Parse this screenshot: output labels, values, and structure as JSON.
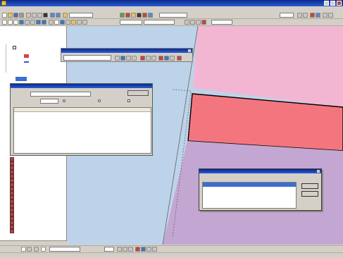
{
  "app": {
    "title": ""
  },
  "menubar": {
    "items": [
      "",
      "",
      "",
      "",
      "",
      "",
      "",
      "",
      "",
      "",
      ""
    ]
  },
  "toolbar": {
    "scale_value": "",
    "layer_combo_value": "",
    "target_combo_value": "",
    "editor_label": "",
    "small_combo_value": "",
    "small_combo2_value": ""
  },
  "toc": {
    "layers_label": "",
    "items": [
      "",
      "",
      "",
      "",
      ""
    ]
  },
  "georef_toolbar": {
    "title": "",
    "combo_value": ""
  },
  "find_dialog": {
    "title": "",
    "input_label": "",
    "input_value": "",
    "in_label": "",
    "option_labels": [
      "",
      "",
      ""
    ],
    "columns": [
      "",
      "",
      "",
      ""
    ],
    "rows": [
      [
        "",
        "",
        "",
        ""
      ]
    ]
  },
  "toolbox": {
    "items": [
      "",
      "",
      "",
      "",
      "",
      "",
      "",
      "",
      "",
      "",
      "",
      "",
      "",
      "",
      "",
      "",
      "",
      "",
      ""
    ]
  },
  "bottom_tabs": [
    "",
    "",
    "",
    ""
  ],
  "drawing_toolbar": {
    "label": "",
    "font_value": "",
    "size_value": ""
  },
  "status": {
    "text": "",
    "coords": ""
  },
  "select_dialog": {
    "title": "",
    "prompt": "",
    "items": [
      "",
      ""
    ],
    "ok_label": "",
    "cancel_label": ""
  },
  "colors": {
    "titlebar": "#1c3f9c",
    "map_blue": "#bdd3ea",
    "pink": "#f2b6d3",
    "red": "#f3767e",
    "purple": "#c4a6d2"
  }
}
